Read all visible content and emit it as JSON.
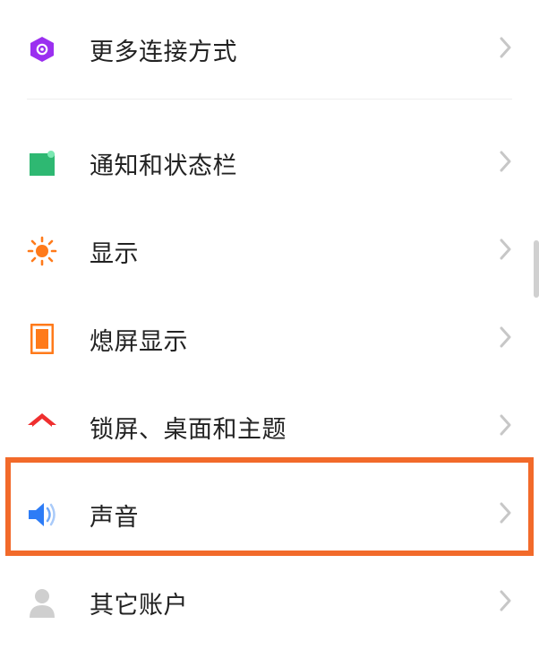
{
  "highlight_color": "#f26a2a",
  "items": [
    {
      "id": "more-connections",
      "label": "更多连接方式"
    },
    {
      "id": "notification-status",
      "label": "通知和状态栏"
    },
    {
      "id": "display",
      "label": "显示"
    },
    {
      "id": "ambient-display",
      "label": "熄屏显示"
    },
    {
      "id": "lockscreen-theme",
      "label": "锁屏、桌面和主题"
    },
    {
      "id": "sound",
      "label": "声音"
    },
    {
      "id": "other-accounts",
      "label": "其它账户"
    }
  ]
}
